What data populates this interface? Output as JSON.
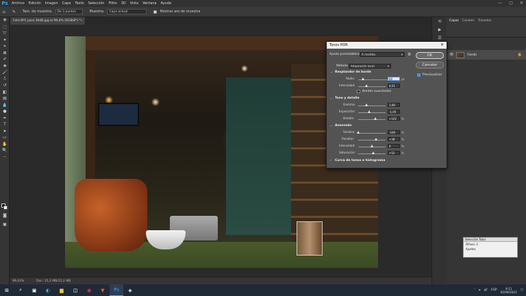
{
  "menubar": {
    "logo": "Ps",
    "items": [
      "Archivo",
      "Edición",
      "Imagen",
      "Capa",
      "Texto",
      "Selección",
      "Filtro",
      "3D",
      "Vista",
      "Ventana",
      "Ayuda"
    ],
    "win_controls": [
      "—",
      "▢",
      "✕"
    ]
  },
  "options_bar": {
    "sample_size_label": "Tam. de muestra:",
    "sample_size_value": "De 3 puntos",
    "sample_label": "Muestra:",
    "sample_value": "Capa actual",
    "show_ring_label": "Mostrar aro de muestra"
  },
  "document": {
    "tab_title": "Foto Nº1 para 30dB.jpg al 99,4% (RGB/8*) *",
    "zoom": "99,43%",
    "doc_size": "Doc: 15,2 MB/15,2 MB"
  },
  "panels": {
    "tabs": [
      "Capas",
      "Canales",
      "Trazados"
    ],
    "layer_name": "Fondo"
  },
  "mini_panel": {
    "title": "Selección Total",
    "row1": "Difuso: 2",
    "row2": "Ajustes"
  },
  "hdr_dialog": {
    "title": "Tonos HDR",
    "preset_label": "Ajuste preestablecido:",
    "preset_value": "A medida",
    "method_label": "Método:",
    "method_value": "Adaptación local",
    "ok_label": "OK",
    "cancel_label": "Cancelar",
    "preview_label": "Previsualizar",
    "edge_glow": {
      "header": "Resplandor de borde",
      "radius_label": "Radio:",
      "radius_value": "60",
      "radius_unit": "px",
      "strength_label": "Intensidad:",
      "strength_value": "0,51",
      "smooth_edges_label": "Bordes suavizados"
    },
    "tone_detail": {
      "header": "Tono y detalle",
      "gamma_label": "Gamma:",
      "gamma_value": "1,06",
      "exposure_label": "Exposición:",
      "exposure_value": "-1,05",
      "detail_label": "Detalle:",
      "detail_value": "+102",
      "detail_unit": "%"
    },
    "advanced": {
      "header": "Avanzado",
      "shadow_label": "Sombra:",
      "shadow_value": "-100",
      "highlight_label": "Resaltar:",
      "highlight_value": "+38",
      "vibrance_label": "Intensidad:",
      "vibrance_value": "0",
      "saturation_label": "Saturación:",
      "saturation_value": "+52",
      "unit": "%"
    },
    "curve_header": "Curva de tonos e histograma"
  },
  "taskbar": {
    "time": "9:11",
    "date": "02/09/2022",
    "lang": "ESP"
  }
}
